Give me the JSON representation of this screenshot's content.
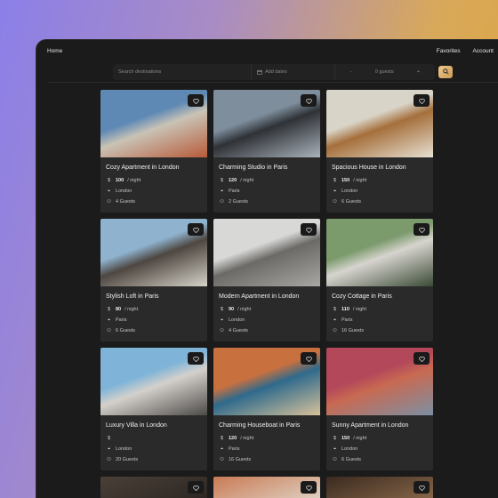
{
  "nav": {
    "home": "Home",
    "favorites": "Favorites",
    "account": "Account"
  },
  "search": {
    "destination_placeholder": "Search destinations",
    "dates_placeholder": "Add dates",
    "guest_minus": "-",
    "guest_count": "0 guests",
    "guest_plus": "+"
  },
  "listings": [
    {
      "title": "Cozy Apartment in London",
      "currency": "$",
      "price": "100",
      "per": "/ night",
      "city": "London",
      "guests": "4 Guests",
      "img": [
        "#5f89b5",
        "#c9c3b5",
        "#b85a3a"
      ]
    },
    {
      "title": "Charming Studio in Paris",
      "currency": "$",
      "price": "120",
      "per": "/ night",
      "city": "Paris",
      "guests": "2 Guests",
      "img": [
        "#7e8e9c",
        "#2f3237",
        "#aab3bb"
      ]
    },
    {
      "title": "Spacious House in London",
      "currency": "$",
      "price": "150",
      "per": "/ night",
      "city": "London",
      "guests": "6 Guests",
      "img": [
        "#d9d4c8",
        "#a56f3b",
        "#e7e1d3"
      ]
    },
    {
      "title": "Stylish Loft in Paris",
      "currency": "$",
      "price": "80",
      "per": "/ night",
      "city": "Paris",
      "guests": "6 Guests",
      "img": [
        "#8fb3cf",
        "#4e4741",
        "#d6d2c9"
      ]
    },
    {
      "title": "Modern Apartment in London",
      "currency": "$",
      "price": "90",
      "per": "/ night",
      "city": "London",
      "guests": "4 Guests",
      "img": [
        "#d8d8d6",
        "#6b6a67",
        "#a9a7a3"
      ]
    },
    {
      "title": "Cozy Cottage in Paris",
      "currency": "$",
      "price": "110",
      "per": "/ night",
      "city": "Paris",
      "guests": "16 Guests",
      "img": [
        "#7c9b6d",
        "#d7d4cf",
        "#3a4a35"
      ]
    },
    {
      "title": "Luxury Villa in London",
      "currency": "$",
      "price": "",
      "per": "",
      "city": "London",
      "guests": "20 Guests",
      "img": [
        "#7fb4d8",
        "#d4d0cb",
        "#4c4a48"
      ]
    },
    {
      "title": "Charming Houseboat in Paris",
      "currency": "$",
      "price": "120",
      "per": "/ night",
      "city": "Paris",
      "guests": "16 Guests",
      "img": [
        "#c9703f",
        "#2f6a8c",
        "#d8c29a"
      ]
    },
    {
      "title": "Sunny Apartment in London",
      "currency": "$",
      "price": "150",
      "per": "/ night",
      "city": "London",
      "guests": "6 Guests",
      "img": [
        "#b3485a",
        "#c86a52",
        "#7c8fa3"
      ]
    }
  ],
  "partial_listings": [
    {
      "img": [
        "#4a4038",
        "#2a2420"
      ]
    },
    {
      "img": [
        "#c97a55",
        "#e0d6c8"
      ]
    },
    {
      "img": [
        "#3b2a20",
        "#8b6a4a"
      ]
    }
  ]
}
